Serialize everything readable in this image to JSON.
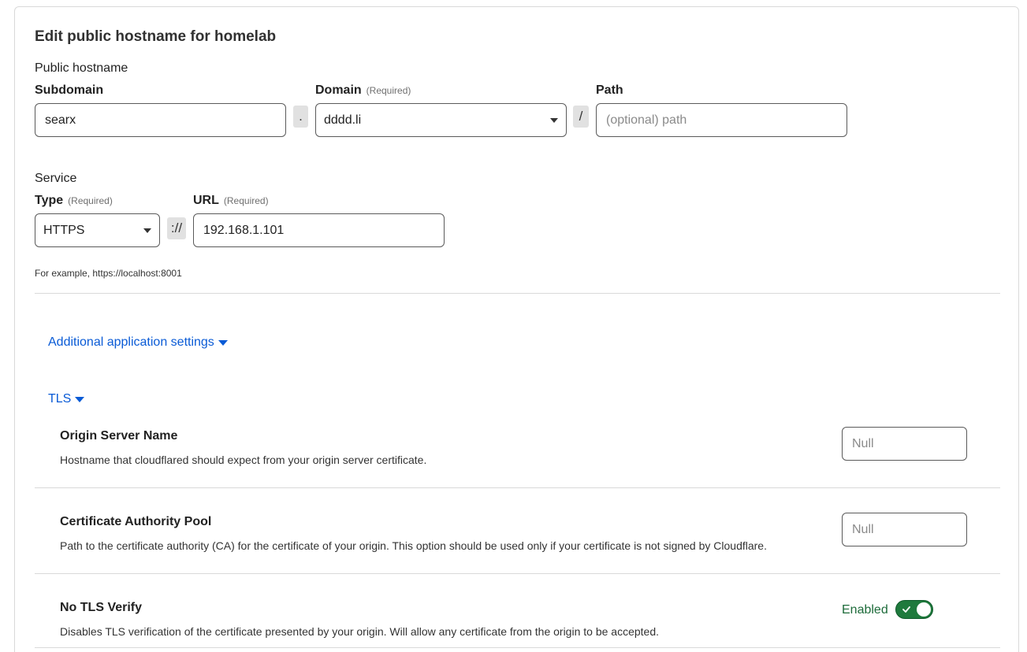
{
  "title": "Edit public hostname for homelab",
  "public_hostname": {
    "section_label": "Public hostname",
    "subdomain": {
      "label": "Subdomain",
      "value": "searx"
    },
    "dot_separator": ".",
    "domain": {
      "label": "Domain",
      "required": "(Required)",
      "value": "dddd.li"
    },
    "slash_separator": "/",
    "path": {
      "label": "Path",
      "placeholder": "(optional) path",
      "value": ""
    }
  },
  "service": {
    "section_label": "Service",
    "type": {
      "label": "Type",
      "required": "(Required)",
      "value": "HTTPS"
    },
    "scheme_separator": "://",
    "url": {
      "label": "URL",
      "required": "(Required)",
      "value": "192.168.1.101"
    },
    "hint": "For example, https://localhost:8001"
  },
  "additional_settings_link": "Additional application settings",
  "tls": {
    "link": "TLS",
    "settings": [
      {
        "title": "Origin Server Name",
        "description": "Hostname that cloudflared should expect from your origin server certificate.",
        "placeholder": "Null"
      },
      {
        "title": "Certificate Authority Pool",
        "description": "Path to the certificate authority (CA) for the certificate of your origin. This option should be used only if your certificate is not signed by Cloudflare.",
        "placeholder": "Null"
      },
      {
        "title": "No TLS Verify",
        "description": "Disables TLS verification of the certificate presented by your origin. Will allow any certificate from the origin to be accepted.",
        "toggle_label": "Enabled",
        "toggle_on": true
      }
    ]
  },
  "colors": {
    "link": "#0a5bd6",
    "toggle_on": "#1f7a3d",
    "border": "#5a5a5a"
  },
  "icons": {
    "dropdown": "caret-down-icon",
    "toggle_check": "check-icon"
  }
}
